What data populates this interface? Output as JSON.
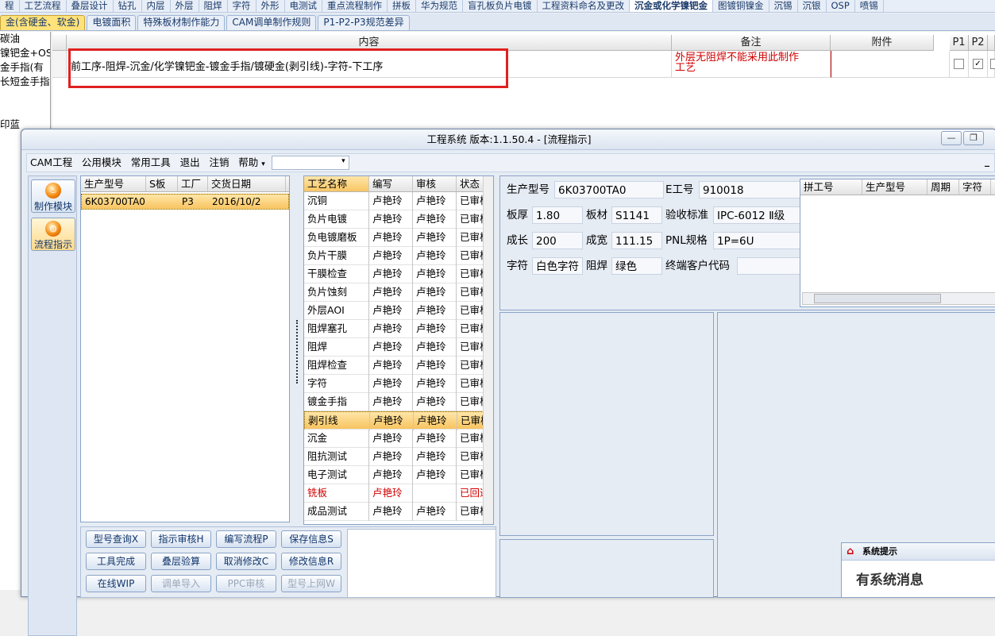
{
  "tabs_row1": [
    "程",
    "工艺流程",
    "叠层设计",
    "钻孔",
    "内层",
    "外层",
    "阻焊",
    "字符",
    "外形",
    "电测试",
    "重点流程制作",
    "拼板",
    "华为规范",
    "盲孔板负片电镀",
    "工程资料命名及更改",
    "沉金或化学镍钯金",
    "图镀铜镍金",
    "沉锡",
    "沉银",
    "OSP",
    "喷锡"
  ],
  "tabs_row1_active": 15,
  "tabs_row2": [
    "金(含硬金、软金)",
    "电镀面积",
    "特殊板材制作能力",
    "CAM调单制作规则",
    "P1-P2-P3规范差异"
  ],
  "left_list": [
    "碳油",
    "镍钯金+OSP",
    "金手指(有",
    "长短金手指",
    "",
    "",
    "印蓝"
  ],
  "grid": {
    "headers": [
      "内容",
      "备注",
      "附件",
      "P1",
      "P2"
    ],
    "row": {
      "content": "前工序-阻焊-沉金/化学镍钯金-镀金手指/镀硬金(剥引线)-字符-下工序",
      "remark_1": "外层无阻焊不能采用此制作",
      "remark_2": "工艺",
      "attachment": "",
      "p1_checked": false,
      "p2_checked": true
    }
  },
  "window": {
    "title": "工程系统   版本:1.1.50.4 - [流程指示]",
    "controls": {
      "minimize": "—",
      "restore": "❐"
    },
    "menu": [
      "CAM工程",
      "公用模块",
      "常用工具",
      "退出",
      "注销",
      "帮助"
    ],
    "menu_arrow": "▾",
    "combo_value": "",
    "right_dash": "_"
  },
  "sidenav": [
    {
      "label": "制作模块",
      "icon": "flame-icon"
    },
    {
      "label": "流程指示",
      "icon": "flow-icon"
    }
  ],
  "order_table": {
    "headers": [
      "生产型号",
      "S板",
      "工厂",
      "交货日期"
    ],
    "rows": [
      [
        "6K03700TA0",
        "",
        "P3",
        "2016/10/2"
      ]
    ]
  },
  "process_table": {
    "headers": [
      "工艺名称",
      "编写",
      "审核",
      "状态"
    ],
    "rows": [
      {
        "name": "沉铜",
        "writer": "卢艳玲",
        "checker": "卢艳玲",
        "status": "已审核",
        "red": false,
        "selected": false
      },
      {
        "name": "负片电镀",
        "writer": "卢艳玲",
        "checker": "卢艳玲",
        "status": "已审核",
        "red": false,
        "selected": false
      },
      {
        "name": "负电镀磨板",
        "writer": "卢艳玲",
        "checker": "卢艳玲",
        "status": "已审核",
        "red": false,
        "selected": false
      },
      {
        "name": "负片干膜",
        "writer": "卢艳玲",
        "checker": "卢艳玲",
        "status": "已审核",
        "red": false,
        "selected": false
      },
      {
        "name": "干膜检查",
        "writer": "卢艳玲",
        "checker": "卢艳玲",
        "status": "已审核",
        "red": false,
        "selected": false
      },
      {
        "name": "负片蚀刻",
        "writer": "卢艳玲",
        "checker": "卢艳玲",
        "status": "已审核",
        "red": false,
        "selected": false
      },
      {
        "name": "外层AOI",
        "writer": "卢艳玲",
        "checker": "卢艳玲",
        "status": "已审核",
        "red": false,
        "selected": false
      },
      {
        "name": "阻焊塞孔",
        "writer": "卢艳玲",
        "checker": "卢艳玲",
        "status": "已审核",
        "red": false,
        "selected": false
      },
      {
        "name": "阻焊",
        "writer": "卢艳玲",
        "checker": "卢艳玲",
        "status": "已审核",
        "red": false,
        "selected": false
      },
      {
        "name": "阻焊检查",
        "writer": "卢艳玲",
        "checker": "卢艳玲",
        "status": "已审核",
        "red": false,
        "selected": false
      },
      {
        "name": "字符",
        "writer": "卢艳玲",
        "checker": "卢艳玲",
        "status": "已审核",
        "red": false,
        "selected": false
      },
      {
        "name": "镀金手指",
        "writer": "卢艳玲",
        "checker": "卢艳玲",
        "status": "已审核",
        "red": false,
        "selected": false
      },
      {
        "name": "剥引线",
        "writer": "卢艳玲",
        "checker": "卢艳玲",
        "status": "已审核",
        "red": false,
        "selected": true
      },
      {
        "name": "沉金",
        "writer": "卢艳玲",
        "checker": "卢艳玲",
        "status": "已审核",
        "red": false,
        "selected": false
      },
      {
        "name": "阻抗测试",
        "writer": "卢艳玲",
        "checker": "卢艳玲",
        "status": "已审核",
        "red": false,
        "selected": false
      },
      {
        "name": "电子测试",
        "writer": "卢艳玲",
        "checker": "卢艳玲",
        "status": "已审核",
        "red": false,
        "selected": false
      },
      {
        "name": "铣板",
        "writer": "卢艳玲",
        "checker": "",
        "status": "已回退",
        "red": true,
        "selected": false
      },
      {
        "name": "成品测试",
        "writer": "卢艳玲",
        "checker": "卢艳玲",
        "status": "已审核",
        "red": false,
        "selected": false
      }
    ]
  },
  "buttons": [
    [
      "型号查询X",
      "指示审核H",
      "编写流程P",
      "保存信息S"
    ],
    [
      "工具完成",
      "叠层验算",
      "取消修改C",
      "修改信息R"
    ],
    [
      "在线WIP",
      "调单导入",
      "PPC审核",
      "型号上网W"
    ]
  ],
  "disabled_buttons": [
    "调单导入",
    "PPC审核",
    "型号上网W"
  ],
  "info": {
    "model_label": "生产型号",
    "model": "6K03700TA0",
    "eno_label": "E工号",
    "eno": "910018",
    "thick_label": "板厚",
    "thick": "1.80",
    "mat_label": "板材",
    "mat": "S1141",
    "std_label": "验收标准",
    "std": "IPC-6012 Ⅱ级",
    "len_label": "成长",
    "len": "200",
    "wid_label": "成宽",
    "wid": "111.15",
    "pnl_label": "PNL规格",
    "pnl": "1P=6U",
    "char_label": "字符",
    "char": "白色字符",
    "mask_label": "阻焊",
    "mask": "绿色",
    "cust_label": "终端客户代码",
    "cust": ""
  },
  "side_grid_headers": [
    "拼工号",
    "生产型号",
    "周期",
    "字符"
  ],
  "sys_msg": {
    "title": "系统提示",
    "body": "有系统消息"
  }
}
